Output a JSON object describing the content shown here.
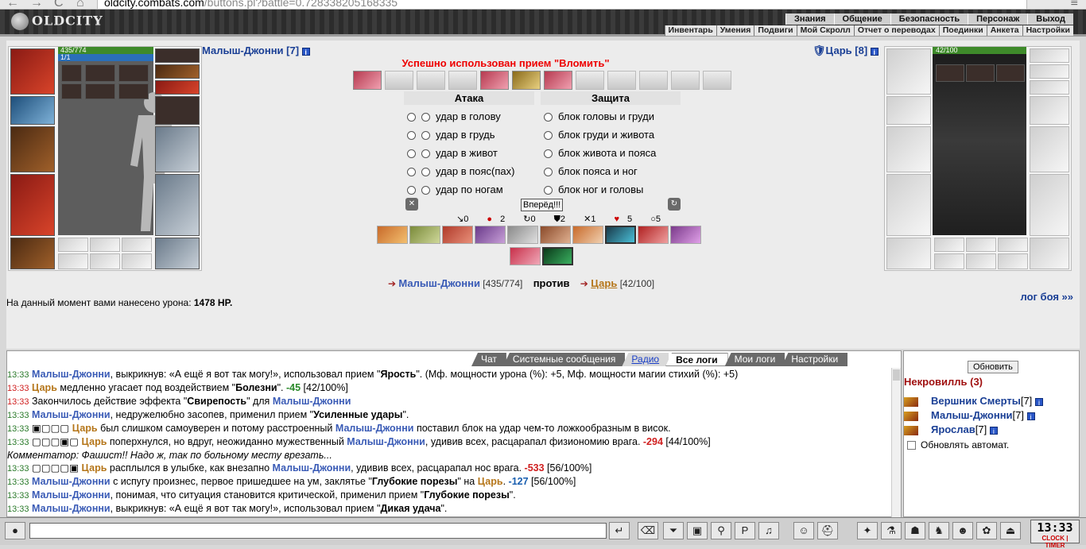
{
  "browser": {
    "host": "oldcity.combats.com",
    "path": "/buttons.pl?battle=0.728338205168335"
  },
  "header": {
    "logo": "OLDCITY",
    "topnav": [
      "Знания",
      "Общение",
      "Безопасность",
      "Персонаж",
      "Выход"
    ],
    "subnav": [
      "Инвентарь",
      "Умения",
      "Подвиги",
      "Мой Скролл",
      "Отчет о переводах",
      "Поединки",
      "Анкета",
      "Настройки"
    ]
  },
  "player": {
    "name": "Малыш-Джонни [7]",
    "hp": "435/774",
    "mp": "1/1"
  },
  "enemy": {
    "name": "Царь [8]",
    "hp": "42/100"
  },
  "battle": {
    "success_msg": "Успешно использован прием \"Вломить\"",
    "attack_header": "Атака",
    "defense_header": "Защита",
    "attacks": [
      "удар в голову",
      "удар в грудь",
      "удар в живот",
      "удар в пояс(пах)",
      "удар по ногам"
    ],
    "blocks": [
      "блок головы и груди",
      "блок груди и живота",
      "блок живота и пояса",
      "блок пояса и ног",
      "блок ног и головы"
    ],
    "forward_btn": "Вперёд!!!",
    "counters": [
      "0",
      "2",
      "0",
      "2",
      "1",
      "5",
      "5"
    ],
    "vs_player": "Малыш-Джонни",
    "vs_player_hp": "[435/774]",
    "vs_word": "против",
    "vs_enemy": "Царь",
    "vs_enemy_hp": "[42/100]",
    "damage_text": "На данный момент вами нанесено урона:",
    "damage_value": "1478 HP.",
    "battle_log_link": "лог боя »»"
  },
  "chat": {
    "tabs": [
      "Чат",
      "Системные сообщения",
      "Радио",
      "Все логи",
      "Мои логи",
      "Настройки"
    ],
    "active_tab": "Все логи"
  },
  "online": {
    "refresh_btn": "Обновить",
    "room": "Некровилль (3)",
    "users": [
      {
        "name": "Вершник Смерты",
        "level": "[7]"
      },
      {
        "name": "Малыш-Джонни",
        "level": "[7]"
      },
      {
        "name": "Ярослав",
        "level": "[7]"
      }
    ],
    "auto_refresh": "Обновлять автомат."
  },
  "clock": {
    "time": "13:33",
    "label_clock": "CLOCK",
    "label_timer": "TIMER"
  }
}
